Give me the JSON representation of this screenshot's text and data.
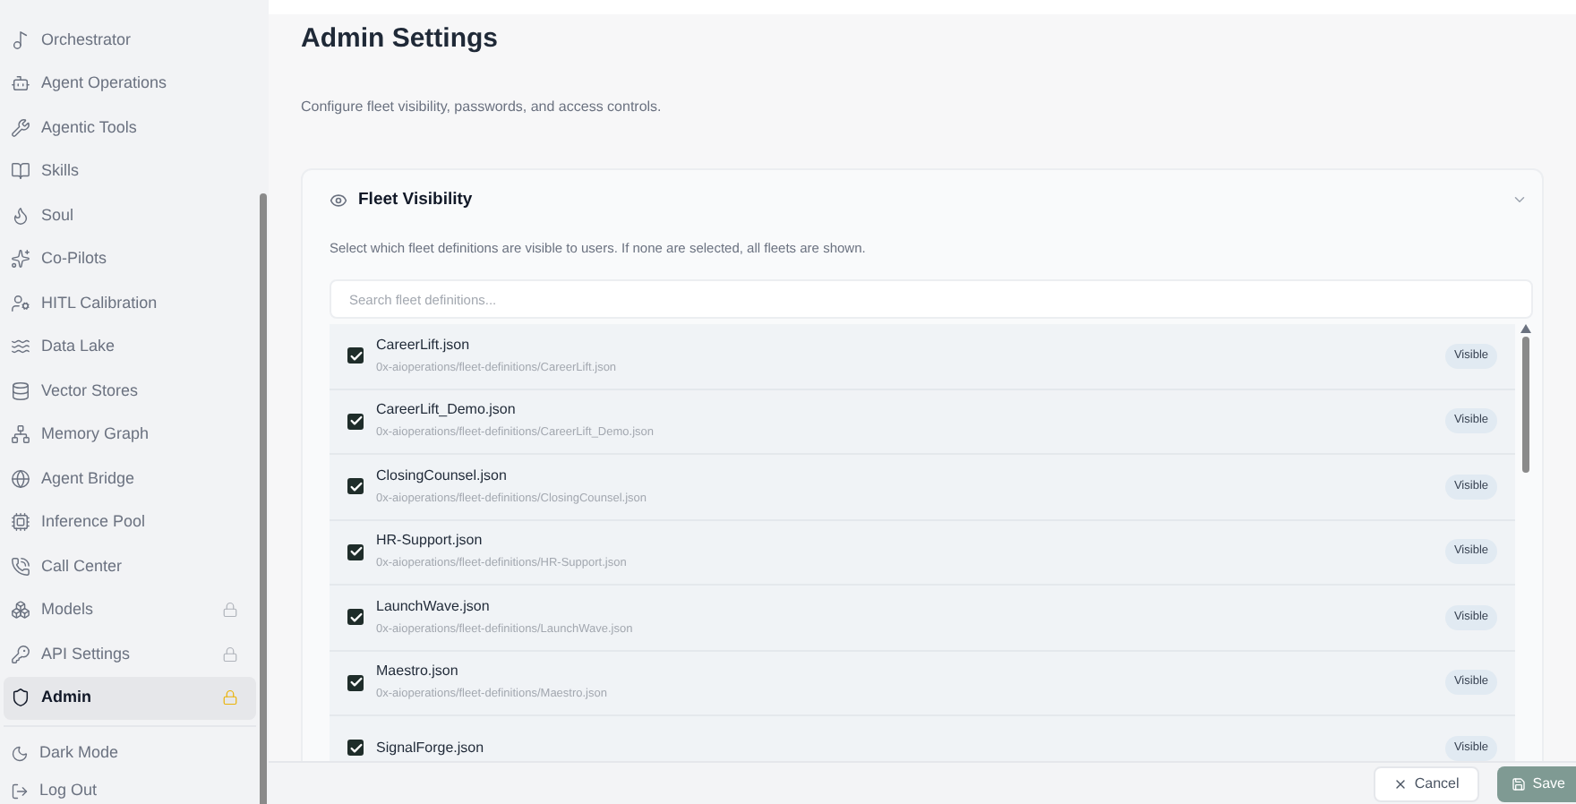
{
  "sidebar": {
    "items": [
      {
        "kind": "orchestrator",
        "label": "Orchestrator",
        "selected": false,
        "locked": false
      },
      {
        "kind": "bot",
        "label": "Agent Operations",
        "selected": false,
        "locked": false
      },
      {
        "kind": "wrench",
        "label": "Agentic Tools",
        "selected": false,
        "locked": false
      },
      {
        "kind": "book",
        "label": "Skills",
        "selected": false,
        "locked": false
      },
      {
        "kind": "flame",
        "label": "Soul",
        "selected": false,
        "locked": false
      },
      {
        "kind": "sparkles",
        "label": "Co-Pilots",
        "selected": false,
        "locked": false
      },
      {
        "kind": "user",
        "label": "HITL Calibration",
        "selected": false,
        "locked": false
      },
      {
        "kind": "waves",
        "label": "Data Lake",
        "selected": false,
        "locked": false
      },
      {
        "kind": "database",
        "label": "Vector Stores",
        "selected": false,
        "locked": false
      },
      {
        "kind": "network",
        "label": "Memory Graph",
        "selected": false,
        "locked": false
      },
      {
        "kind": "globe",
        "label": "Agent Bridge",
        "selected": false,
        "locked": false
      },
      {
        "kind": "cpu",
        "label": "Inference Pool",
        "selected": false,
        "locked": false
      },
      {
        "kind": "phone",
        "label": "Call Center",
        "selected": false,
        "locked": false
      },
      {
        "kind": "boxes",
        "label": "Models",
        "selected": false,
        "locked": true
      },
      {
        "kind": "key",
        "label": "API Settings",
        "selected": false,
        "locked": true
      },
      {
        "kind": "shield",
        "label": "Admin",
        "selected": true,
        "locked": true
      }
    ],
    "footer": [
      {
        "kind": "moon",
        "label": "Dark Mode"
      },
      {
        "kind": "logout",
        "label": "Log Out"
      }
    ]
  },
  "title": "Admin Settings",
  "description": "Configure fleet visibility, passwords, and access controls.",
  "section": {
    "title": "Fleet Visibility",
    "expanded": true,
    "description": "Select which fleet definitions are visible to users. If none are selected, all fleets are shown.",
    "search": {
      "placeholder": "Search fleet definitions..."
    },
    "fleets": [
      {
        "name": "CareerLift.json",
        "path": "0x-aioperations/fleet-definitions/CareerLift.json",
        "checked": true,
        "badge": "Visible"
      },
      {
        "name": "CareerLift_Demo.json",
        "path": "0x-aioperations/fleet-definitions/CareerLift_Demo.json",
        "checked": true,
        "badge": "Visible"
      },
      {
        "name": "ClosingCounsel.json",
        "path": "0x-aioperations/fleet-definitions/ClosingCounsel.json",
        "checked": true,
        "badge": "Visible"
      },
      {
        "name": "HR-Support.json",
        "path": "0x-aioperations/fleet-definitions/HR-Support.json",
        "checked": true,
        "badge": "Visible"
      },
      {
        "name": "LaunchWave.json",
        "path": "0x-aioperations/fleet-definitions/LaunchWave.json",
        "checked": true,
        "badge": "Visible"
      },
      {
        "name": "Maestro.json",
        "path": "0x-aioperations/fleet-definitions/Maestro.json",
        "checked": true,
        "badge": "Visible"
      },
      {
        "name": "SignalForge.json",
        "checked": true,
        "badge": "Visible"
      }
    ]
  },
  "buttons": {
    "cancel": "Cancel",
    "save": "Save"
  }
}
